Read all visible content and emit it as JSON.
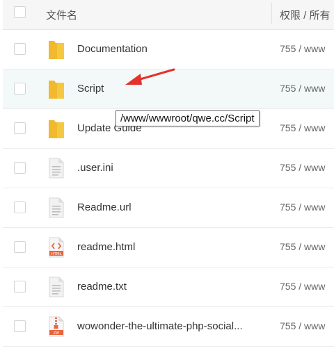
{
  "header": {
    "name_label": "文件名",
    "perm_label": "权限 / 所有"
  },
  "rows": [
    {
      "name": "Documentation",
      "perm": "755 / www",
      "icon": "folder-icon"
    },
    {
      "name": "Script",
      "perm": "755 / www",
      "icon": "folder-icon"
    },
    {
      "name": "Update Guide",
      "perm": "755 / www",
      "icon": "folder-icon"
    },
    {
      "name": ".user.ini",
      "perm": "755 / www",
      "icon": "file-icon"
    },
    {
      "name": "Readme.url",
      "perm": "755 / www",
      "icon": "file-icon"
    },
    {
      "name": "readme.html",
      "perm": "755 / www",
      "icon": "html-file-icon"
    },
    {
      "name": "readme.txt",
      "perm": "755 / www",
      "icon": "file-icon"
    },
    {
      "name": "wowonder-the-ultimate-php-social...",
      "perm": "755 / www",
      "icon": "zip-file-icon"
    }
  ],
  "tooltip": {
    "text": "/www/wwwroot/qwe.cc/Script"
  },
  "colors": {
    "folder": "#f5c842",
    "hover_row": "#f3f9f9",
    "arrow": "#e5322d",
    "html_badge": "#e8643c"
  }
}
